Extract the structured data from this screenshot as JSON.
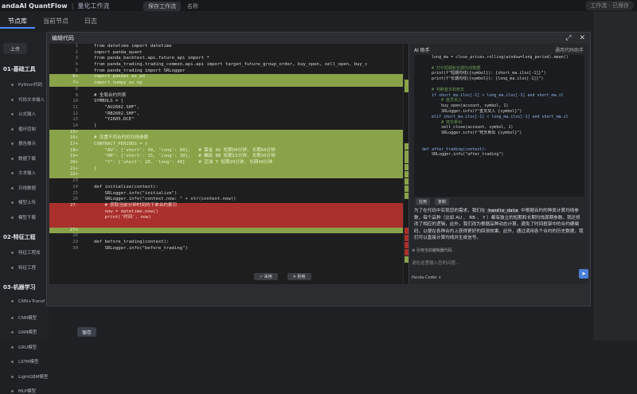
{
  "topbar": {
    "brand": "andaAI QuantFlow",
    "subtitle": "量化工作流",
    "mid_btn": "保存工作流",
    "mid_text": "名称",
    "right": "工作流 · 已保存"
  },
  "tabs": [
    "节点库",
    "当前节点",
    "日志"
  ],
  "sidebar": {
    "upload": "上传",
    "categories": [
      {
        "title": "01-基础工具",
        "items": [
          "Python代码",
          "代码文本输入",
          "公式输入",
          "循环控制",
          "报告展示",
          "数据下载",
          "文本输入",
          "日线数据",
          "模型上传",
          "模型下载"
        ]
      },
      {
        "title": "02-特征工程",
        "items": [
          "特征工程加",
          "特征工程"
        ]
      },
      {
        "title": "03-机器学习",
        "items": [
          "CNN+Transf",
          "CNN模型",
          "GNN模型",
          "GRU模型",
          "LSTM模型",
          "LightGBM模型",
          "MLP模型"
        ]
      }
    ]
  },
  "modal": {
    "title": "编辑代码",
    "expand_icon": "expand-icon",
    "close_icon": "close-icon",
    "save": "保存"
  },
  "diff_buttons": {
    "accept": "✓ 采用",
    "reject": "✕ 拒绝"
  },
  "code_lines": [
    {
      "n": "1",
      "t": "from datetime import datetime",
      "s": ""
    },
    {
      "n": "2",
      "t": "import panda_quant",
      "s": ""
    },
    {
      "n": "3",
      "t": "from panda_backtest.api.future_api import *",
      "s": ""
    },
    {
      "n": "4",
      "t": "from panda_trading.trading_common.api.api import target_future_group_order, buy_open, sell_open, buy_c",
      "s": ""
    },
    {
      "n": "5",
      "t": "from panda_trading import SRLogger",
      "s": ""
    },
    {
      "n": "6+",
      "t": "import pandas as pd",
      "s": "add"
    },
    {
      "n": "7+",
      "t": "import numpy as np",
      "s": "add"
    },
    {
      "n": "8",
      "t": "",
      "s": ""
    },
    {
      "n": "9",
      "t": "# 全局合约列表",
      "s": ""
    },
    {
      "n": "10",
      "t": "SYMBOLS = [",
      "s": ""
    },
    {
      "n": "11",
      "t": "    \"AU2602.SHF\",",
      "s": ""
    },
    {
      "n": "12",
      "t": "    \"RB2602.SHF\",",
      "s": ""
    },
    {
      "n": "13",
      "t": "    \"Y2605.DCE\"",
      "s": ""
    },
    {
      "n": "14",
      "t": "]",
      "s": ""
    },
    {
      "n": "15+",
      "t": "",
      "s": "add"
    },
    {
      "n": "16+",
      "t": "# 设置不同合约的均线参数",
      "s": "add"
    },
    {
      "n": "17+",
      "t": "CONTRACT_PERIODS = {",
      "s": "add"
    },
    {
      "n": "18+",
      "t": "    \"AU\": {'short': 30, 'long': 60},   # 黄金 AU 短期30分钟, 长期60分钟",
      "s": "add"
    },
    {
      "n": "19+",
      "t": "    \"RB\": {'short': 15, 'long': 30},   # 螺纹 RB 短期15分钟, 长期30分钟",
      "s": "add"
    },
    {
      "n": "20+",
      "t": "    \"Y\": {'short': 20, 'long': 40}     # 豆油 Y 短期20分钟, 长期40分钟",
      "s": "add"
    },
    {
      "n": "21+",
      "t": "}",
      "s": "add"
    },
    {
      "n": "22+",
      "t": "",
      "s": "add"
    },
    {
      "n": "23",
      "t": "",
      "s": ""
    },
    {
      "n": "24",
      "t": "def initialize(context):",
      "s": ""
    },
    {
      "n": "25",
      "t": "    SRLogger.info(\"initialize\")",
      "s": ""
    },
    {
      "n": "26",
      "t": "    SRLogger.info(\"context.now: \" + str(context.now))",
      "s": ""
    },
    {
      "n": "27-",
      "t": "    # 获取当前分钟时间的下单合约索引",
      "s": "del"
    },
    {
      "n": "",
      "t": "    now = datetime.now()",
      "s": "del"
    },
    {
      "n": "",
      "t": "    print('时间', now)",
      "s": "del"
    },
    {
      "n": "",
      "t": "",
      "s": "del"
    },
    {
      "n": "27+",
      "t": "",
      "s": "add"
    },
    {
      "n": "28",
      "t": "",
      "s": ""
    },
    {
      "n": "29",
      "t": "def before_trading(context):",
      "s": ""
    },
    {
      "n": "30",
      "t": "    SRLogger.info(\"before_trading\")",
      "s": ""
    }
  ],
  "assistant": {
    "title": "AI 助手",
    "model": "通用代码助手",
    "code": [
      "    long_ma = close_prices.rolling(window=long_period).mean()",
      "",
      "    # 打印短期和长期均线数据",
      "    print(f\"短期均线({symbol}): {short_ma.iloc[-1]}\")",
      "    print(f\"长期均线({symbol}): {long_ma.iloc[-1]}\")",
      "",
      "    # 判断金叉和死叉",
      "    if short_ma.iloc[-1] > long_ma.iloc[-1] and short_ma.il",
      "        # 金叉买入",
      "        buy_open(account, symbol, 1)",
      "        SRLogger.info(f\"金叉买入 {symbol}\")",
      "    elif short_ma.iloc[-1] < long_ma.iloc[-1] and short_ma.il",
      "        # 死叉卖出",
      "        sell_close(account, symbol, 1)",
      "        SRLogger.info(f\"死叉卖出 {symbol}\")",
      "",
      "",
      "def after_trading(context):",
      "    SRLogger.info(\"after_trading\")"
    ],
    "apply": "应用",
    "copy": "复制",
    "explain_pre": "为了在代码中实现您的需求，我们在",
    "explain_chip": "handle_data",
    "explain_post": "中根据合约的种类计算均线参数，每个品种（比如 AU 、 RB 、 Y ）都有独立的短期和长期均线周期参数。我还修改了相应的逻辑，此外，我们改为根据品种动态计算，避免了时间框架中的合约硬编码，以便在各种合约上获得更好的回测效果。此外，通过调用各个合约的历史数据，我们可以直接计算均线并生成信号。",
    "attach": "引用当前编辑器代码",
    "input_placeholder": "请在这里输入您的问题...",
    "model_select": "Panda-Coder ∨",
    "send_icon": "send-icon"
  }
}
